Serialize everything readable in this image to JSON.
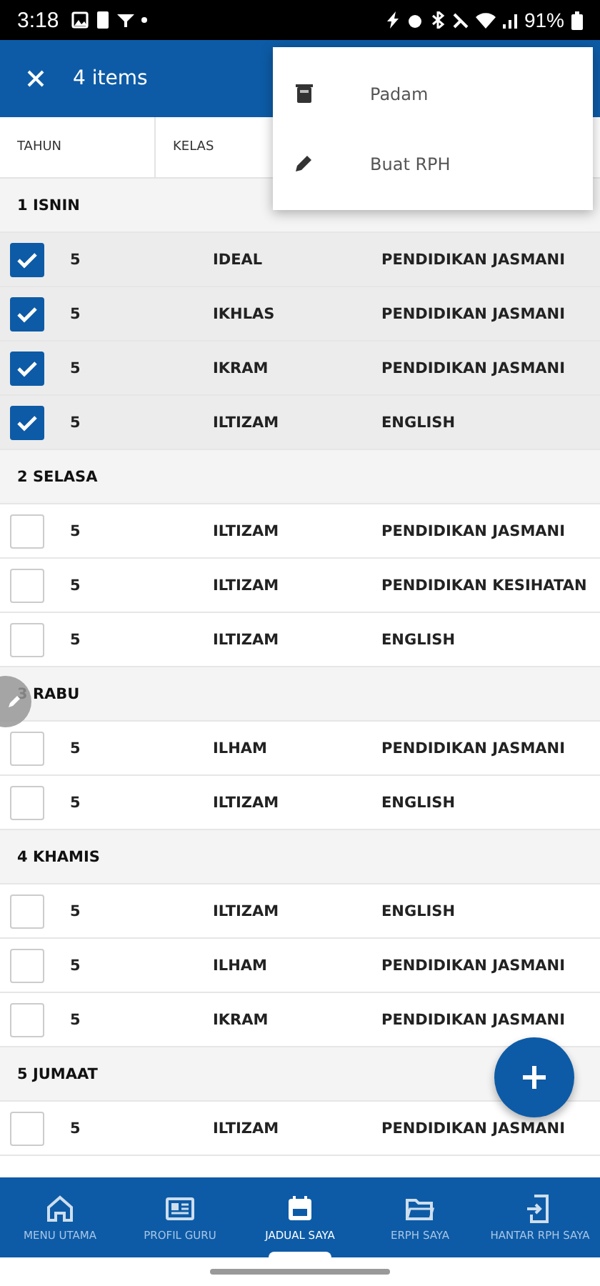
{
  "status_bar": {
    "time": "3:18",
    "battery": "91%"
  },
  "app_bar": {
    "title": "4 items"
  },
  "columns": [
    "TAHUN",
    "KELAS"
  ],
  "menu": [
    {
      "label": "Padam"
    },
    {
      "label": "Buat RPH"
    }
  ],
  "sections": [
    {
      "title": "1 ISNIN",
      "rows": [
        {
          "year": "5",
          "class": "IDEAL",
          "subject": "PENDIDIKAN JASMANI",
          "selected": true
        },
        {
          "year": "5",
          "class": "IKHLAS",
          "subject": "PENDIDIKAN JASMANI",
          "selected": true
        },
        {
          "year": "5",
          "class": "IKRAM",
          "subject": "PENDIDIKAN JASMANI",
          "selected": true
        },
        {
          "year": "5",
          "class": "ILTIZAM",
          "subject": "ENGLISH",
          "selected": true
        }
      ]
    },
    {
      "title": "2 SELASA",
      "rows": [
        {
          "year": "5",
          "class": "ILTIZAM",
          "subject": "PENDIDIKAN JASMANI",
          "selected": false
        },
        {
          "year": "5",
          "class": "ILTIZAM",
          "subject": "PENDIDIKAN KESIHATAN",
          "selected": false
        },
        {
          "year": "5",
          "class": "ILTIZAM",
          "subject": "ENGLISH",
          "selected": false
        }
      ]
    },
    {
      "title": "3 RABU",
      "rows": [
        {
          "year": "5",
          "class": "ILHAM",
          "subject": "PENDIDIKAN JASMANI",
          "selected": false
        },
        {
          "year": "5",
          "class": "ILTIZAM",
          "subject": "ENGLISH",
          "selected": false
        }
      ]
    },
    {
      "title": "4 KHAMIS",
      "rows": [
        {
          "year": "5",
          "class": "ILTIZAM",
          "subject": "ENGLISH",
          "selected": false
        },
        {
          "year": "5",
          "class": "ILHAM",
          "subject": "PENDIDIKAN JASMANI",
          "selected": false
        },
        {
          "year": "5",
          "class": "IKRAM",
          "subject": "PENDIDIKAN JASMANI",
          "selected": false
        }
      ]
    },
    {
      "title": "5 JUMAAT",
      "rows": [
        {
          "year": "5",
          "class": "ILTIZAM",
          "subject": "PENDIDIKAN JASMANI",
          "selected": false
        }
      ]
    }
  ],
  "nav": [
    {
      "label": "MENU UTAMA",
      "selected": false
    },
    {
      "label": "PROFIL GURU",
      "selected": false
    },
    {
      "label": "JADUAL SAYA",
      "selected": true
    },
    {
      "label": "ERPH SAYA",
      "selected": false
    },
    {
      "label": "HANTAR RPH SAYA",
      "selected": false
    }
  ]
}
